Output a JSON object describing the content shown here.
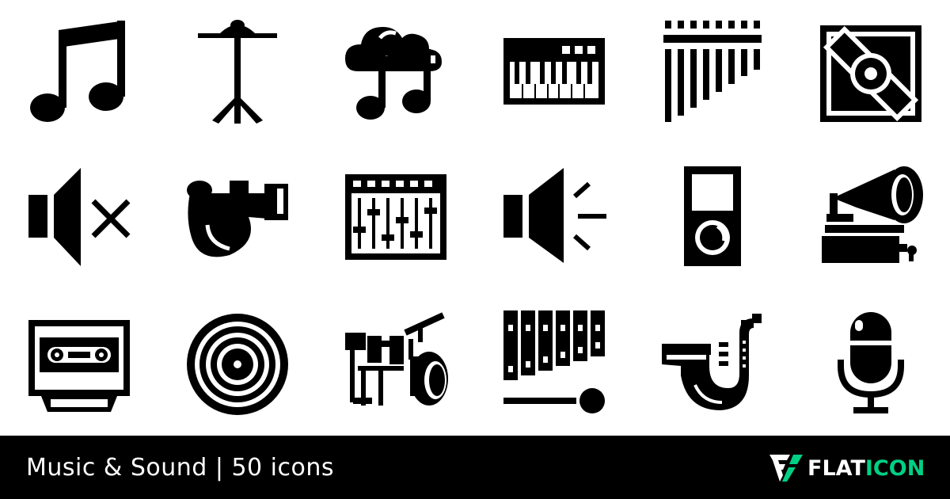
{
  "icons": [
    {
      "name": "music-note-icon"
    },
    {
      "name": "cymbal-stand-icon"
    },
    {
      "name": "cloud-music-icon"
    },
    {
      "name": "keyboard-synth-icon"
    },
    {
      "name": "pan-flute-icon"
    },
    {
      "name": "speaker-box-icon"
    },
    {
      "name": "mute-speaker-icon"
    },
    {
      "name": "whistle-icon"
    },
    {
      "name": "mixer-console-icon"
    },
    {
      "name": "speaker-volume-icon"
    },
    {
      "name": "mp3-player-icon"
    },
    {
      "name": "gramophone-icon"
    },
    {
      "name": "cassette-tape-icon"
    },
    {
      "name": "vinyl-record-icon"
    },
    {
      "name": "drum-kit-icon"
    },
    {
      "name": "xylophone-icon"
    },
    {
      "name": "saxophone-icon"
    },
    {
      "name": "microphone-icon"
    }
  ],
  "footer": {
    "title": "Music & Sound | 50 icons",
    "brand_part1": "FLAT",
    "brand_part2": "ICON",
    "brand_color": "#00d084",
    "background": "#000000"
  }
}
